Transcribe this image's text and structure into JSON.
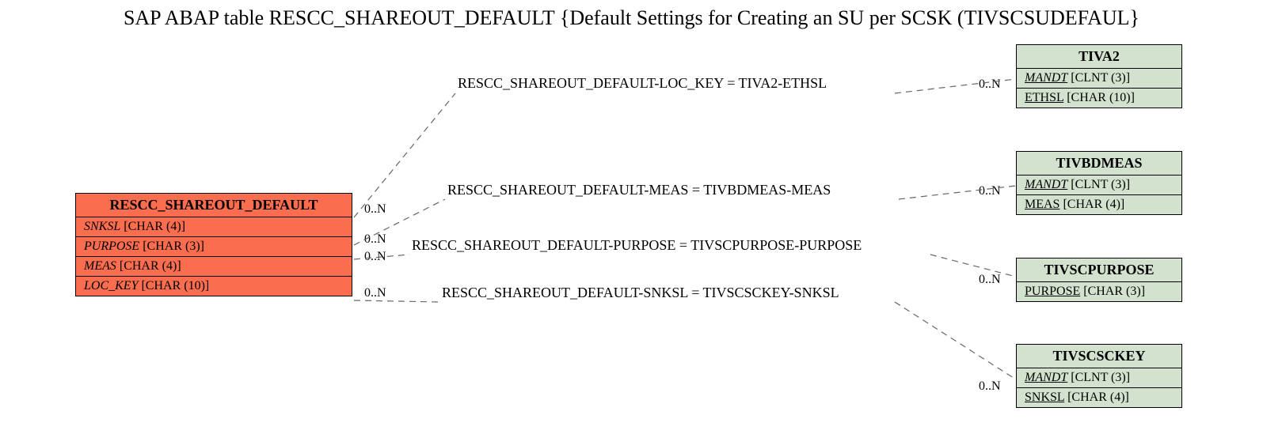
{
  "title": "SAP ABAP table RESCC_SHAREOUT_DEFAULT {Default Settings for Creating an SU per SCSK (TIVSCSUDEFAUL}",
  "main": {
    "name": "RESCC_SHAREOUT_DEFAULT",
    "fields": {
      "f1": {
        "name": "SNKSL",
        "type": "[CHAR (4)]"
      },
      "f2": {
        "name": "PURPOSE",
        "type": "[CHAR (3)]"
      },
      "f3": {
        "name": "MEAS",
        "type": "[CHAR (4)]"
      },
      "f4": {
        "name": "LOC_KEY",
        "type": "[CHAR (10)]"
      }
    }
  },
  "refs": {
    "tiva2": {
      "name": "TIVA2",
      "f1": {
        "name": "MANDT",
        "type": "[CLNT (3)]"
      },
      "f2": {
        "name": "ETHSL",
        "type": "[CHAR (10)]"
      }
    },
    "tivbdmeas": {
      "name": "TIVBDMEAS",
      "f1": {
        "name": "MANDT",
        "type": "[CLNT (3)]"
      },
      "f2": {
        "name": "MEAS",
        "type": "[CHAR (4)]"
      }
    },
    "tivscpurpose": {
      "name": "TIVSCPURPOSE",
      "f1": {
        "name": "PURPOSE",
        "type": "[CHAR (3)]"
      }
    },
    "tivscsckey": {
      "name": "TIVSCSCKEY",
      "f1": {
        "name": "MANDT",
        "type": "[CLNT (3)]"
      },
      "f2": {
        "name": "SNKSL",
        "type": "[CHAR (4)]"
      }
    }
  },
  "rel": {
    "r1": "RESCC_SHAREOUT_DEFAULT-LOC_KEY = TIVA2-ETHSL",
    "r2": "RESCC_SHAREOUT_DEFAULT-MEAS = TIVBDMEAS-MEAS",
    "r3": "RESCC_SHAREOUT_DEFAULT-PURPOSE = TIVSCPURPOSE-PURPOSE",
    "r4": "RESCC_SHAREOUT_DEFAULT-SNKSL = TIVSCSCKEY-SNKSL"
  },
  "card": "0..N"
}
